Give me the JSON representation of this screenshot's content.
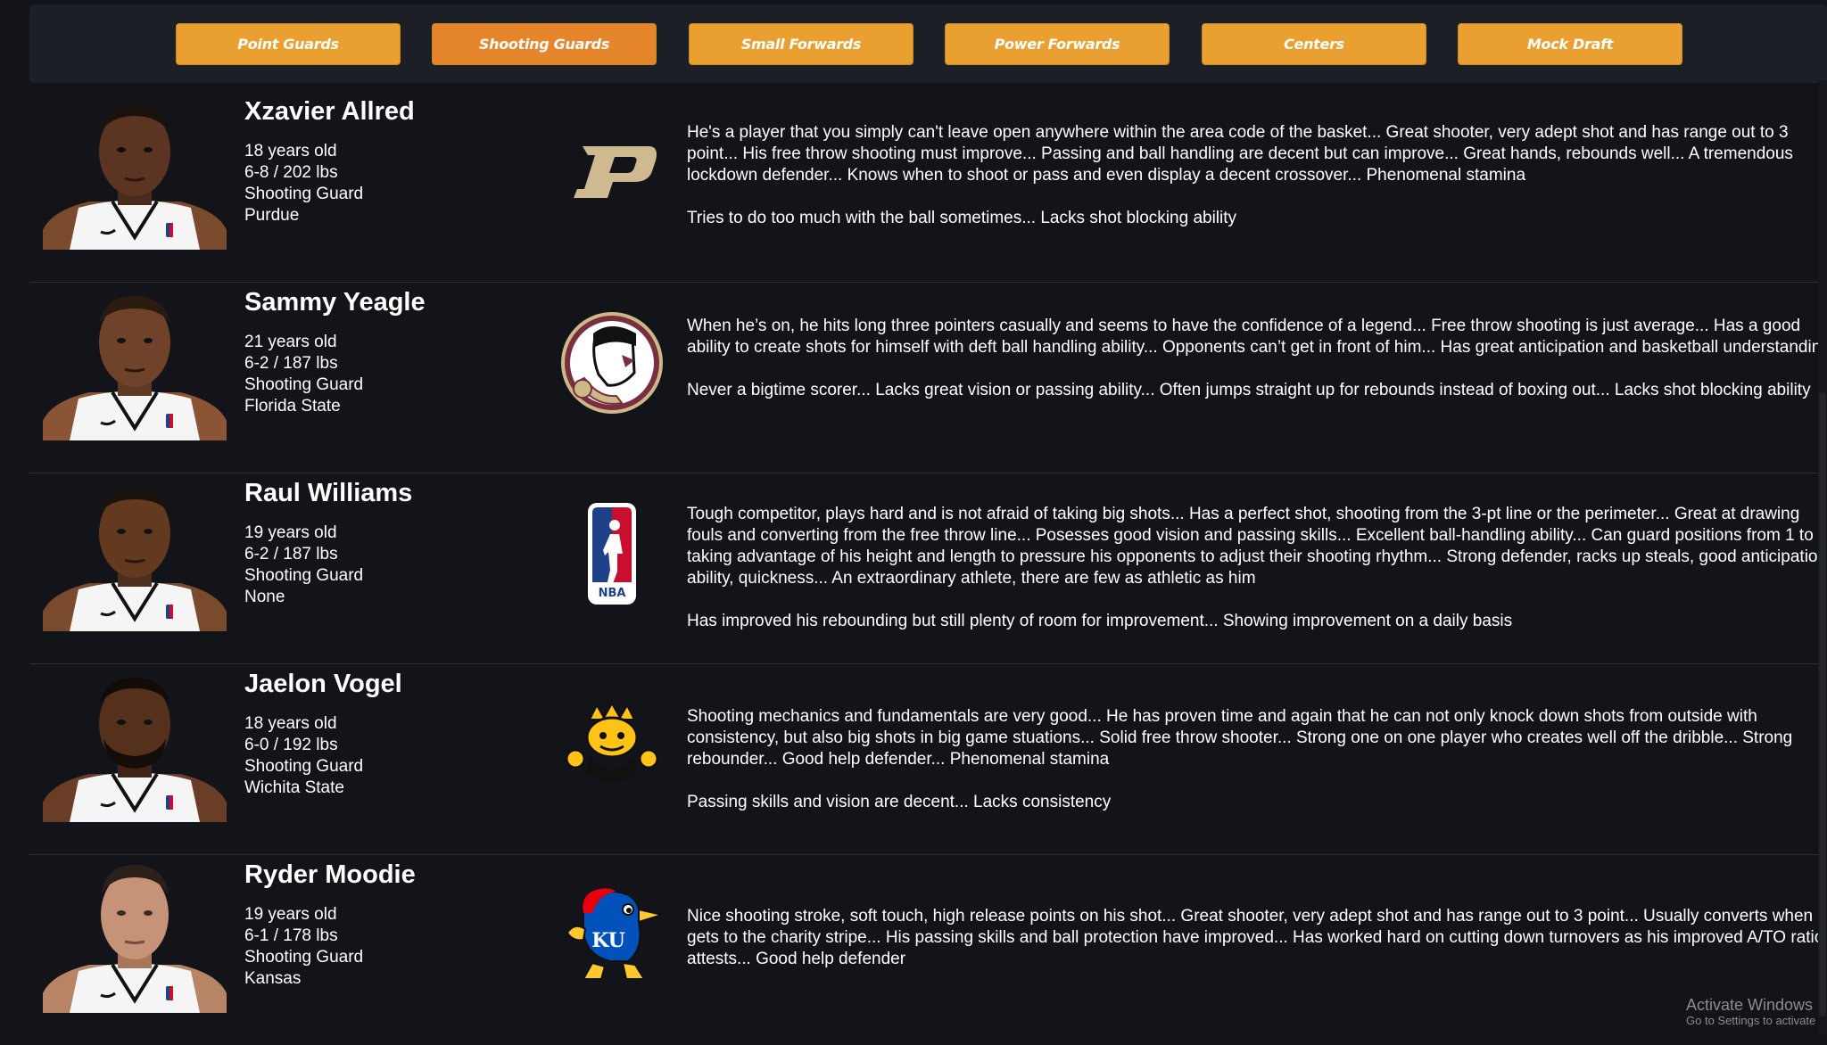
{
  "nav": {
    "buttons": [
      {
        "label": "Point Guards"
      },
      {
        "label": "Shooting Guards"
      },
      {
        "label": "Small Forwards"
      },
      {
        "label": "Power Forwards"
      },
      {
        "label": "Centers"
      },
      {
        "label": "Mock Draft"
      }
    ],
    "active_index": 1
  },
  "players": [
    {
      "name": "Xzavier Allred",
      "age": "18 years old",
      "size": "6-8 / 202 lbs",
      "position": "Shooting Guard",
      "school": "Purdue",
      "logo_icon": "purdue-logo-icon",
      "logo_text": "P",
      "strengths": "He's a player that you simply can't leave open anywhere within the area code of the basket... Great shooter, very adept shot and has range out to 3 point... His free throw shooting must improve... Passing and ball handling are decent but can improve... Great hands, rebounds well... A tremendous lockdown defender... Knows when to shoot or pass and even display a decent crossover... Phenomenal stamina",
      "weaknesses": "Tries to do too much with the ball sometimes... Lacks shot blocking ability"
    },
    {
      "name": "Sammy Yeagle",
      "age": "21 years old",
      "size": "6-2 / 187 lbs",
      "position": "Shooting Guard",
      "school": "Florida State",
      "logo_icon": "florida-state-logo-icon",
      "strengths": "When he’s on, he hits long three pointers casually and seems to have the confidence of a legend... Free throw shooting is just average... Has a good ability to create shots for himself with deft ball handling ability... Opponents can’t get in front of him... Has great anticipation and basketball understanding",
      "weaknesses": "Never a bigtime scorer... Lacks great vision or passing ability... Often jumps straight up for rebounds instead of boxing out... Lacks shot blocking ability"
    },
    {
      "name": "Raul Williams",
      "age": "19 years old",
      "size": "6-2 / 187 lbs",
      "position": "Shooting Guard",
      "school": "None",
      "logo_icon": "nba-logo-icon",
      "logo_text": "NBA",
      "strengths": "Tough competitor, plays hard and is not afraid of taking big shots... Has a perfect shot, shooting from the 3-pt line or the perimeter... Great at drawing fouls and converting from the free throw line... Posesses good vision and passing skills... Excellent ball-handling ability... Can guard positions from 1 to 4, taking advantage of his height and length to pressure his opponents to adjust their shooting rhythm... Strong defender, racks up steals, good anticipation ability, quickness... An extraordinary athlete, there are few as athletic as him",
      "weaknesses": "Has improved his rebounding but still plenty of room for improvement... Showing improvement on a daily basis"
    },
    {
      "name": "Jaelon Vogel",
      "age": "18 years old",
      "size": "6-0 / 192 lbs",
      "position": "Shooting Guard",
      "school": "Wichita State",
      "logo_icon": "wichita-state-logo-icon",
      "strengths": "Shooting mechanics and fundamentals are very good... He has proven time and again that he can not only knock down shots from outside with consistency, but also big shots in big game stuations... Solid free throw shooter... Strong one on one player who creates well off the dribble... Strong rebounder... Good help defender... Phenomenal stamina",
      "weaknesses": "Passing skills and vision are decent... Lacks consistency"
    },
    {
      "name": "Ryder Moodie",
      "age": "19 years old",
      "size": "6-1 / 178 lbs",
      "position": "Shooting Guard",
      "school": "Kansas",
      "logo_icon": "kansas-logo-icon",
      "logo_text": "KU",
      "strengths": "Nice shooting stroke, soft touch, high release points on his shot... Great shooter, very adept shot and has range out to 3 point... Usually converts when he gets to the charity stripe... His passing skills and ball protection have improved... Has worked hard on cutting down turnovers as his improved A/TO ratio attests... Good help defender",
      "weaknesses": ""
    }
  ],
  "watermark": {
    "line1": "Activate Windows",
    "line2": "Go to Settings to activate"
  },
  "colors": {
    "background": "#121419",
    "nav_bg": "#1c1f25",
    "button": "#eaa031",
    "button_active": "#e5862c"
  }
}
